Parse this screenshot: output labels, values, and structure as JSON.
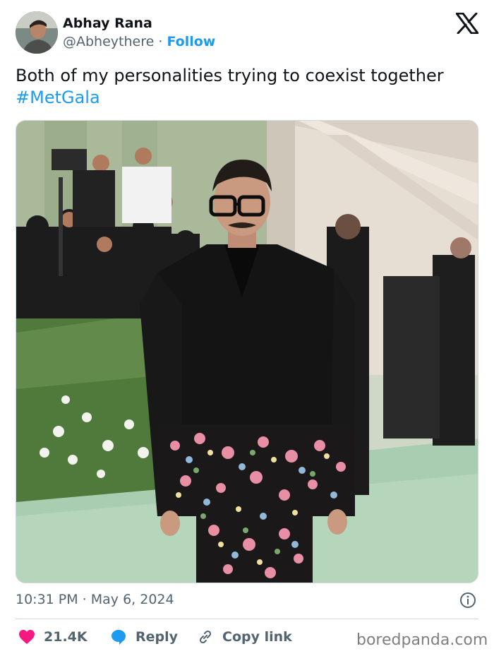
{
  "author": {
    "name": "Abhay Rana",
    "handle": "@Abheythere",
    "separator": "·",
    "follow_label": "Follow"
  },
  "platform_icon": "x-logo-icon",
  "tweet": {
    "text": "Both of my personalities trying to coexist together",
    "hashtag": "#MetGala"
  },
  "media": {
    "type": "photo",
    "subject": "man-in-black-suit-with-floral-hem-on-green-carpet"
  },
  "meta": {
    "timestamp": "10:31 PM · May 6, 2024",
    "info_icon": "info-icon"
  },
  "actions": {
    "likes": "21.4K",
    "reply_label": "Reply",
    "copy_label": "Copy link"
  },
  "colors": {
    "like": "#f91880",
    "link": "#1d9bf0",
    "text": "#0f1419",
    "muted": "#536471"
  },
  "watermark": "boredpanda.com"
}
